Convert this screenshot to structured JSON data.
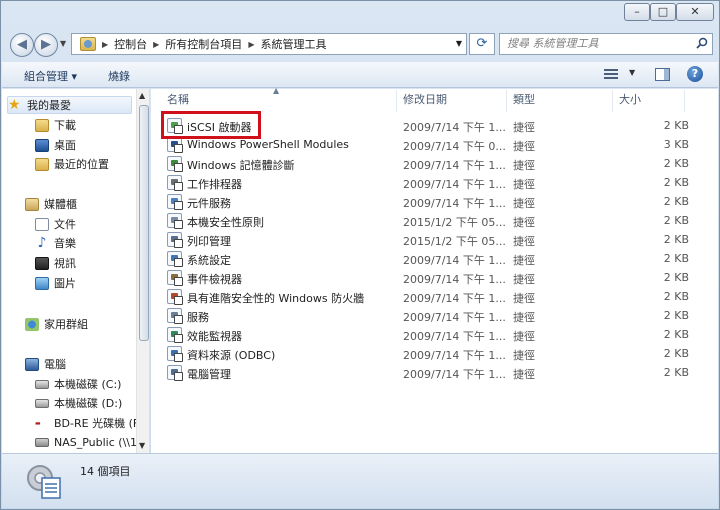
{
  "window": {
    "minimize_glyph": "–",
    "maximize_glyph": "□",
    "close_glyph": "✕"
  },
  "address_bar": {
    "breadcrumbs": [
      "控制台",
      "所有控制台項目",
      "系統管理工具"
    ]
  },
  "search": {
    "placeholder": "搜尋 系統管理工具"
  },
  "toolbar": {
    "organize_label": "組合管理 ▾",
    "burn_label": "燒錄"
  },
  "sidebar": {
    "favorites": {
      "label": "我的最愛",
      "items": [
        "下載",
        "桌面",
        "最近的位置"
      ]
    },
    "libraries": {
      "label": "媒體櫃",
      "items": [
        "文件",
        "音樂",
        "視訊",
        "圖片"
      ]
    },
    "homegroup": {
      "label": "家用群組"
    },
    "computer": {
      "label": "電腦",
      "items": [
        "本機磁碟 (C:)",
        "本機磁碟 (D:)",
        "BD-RE 光碟機 (F",
        "NAS_Public (\\\\1"
      ]
    }
  },
  "columns": {
    "name": "名稱",
    "modified": "修改日期",
    "type": "類型",
    "size": "大小"
  },
  "files": [
    {
      "name": "iSCSI 啟動器",
      "modified": "2009/7/14 下午 1...",
      "type": "捷徑",
      "size": "2 KB",
      "icon": "iscsi-icon",
      "color": "#4aa04a"
    },
    {
      "name": "Windows PowerShell Modules",
      "modified": "2009/7/14 下午 0...",
      "type": "捷徑",
      "size": "3 KB",
      "icon": "powershell-icon",
      "color": "#2a4f8f"
    },
    {
      "name": "Windows 記憶體診斷",
      "modified": "2009/7/14 下午 1...",
      "type": "捷徑",
      "size": "2 KB",
      "icon": "memory-diagnostic-icon",
      "color": "#3c8c3c"
    },
    {
      "name": "工作排程器",
      "modified": "2009/7/14 下午 1...",
      "type": "捷徑",
      "size": "2 KB",
      "icon": "task-scheduler-icon",
      "color": "#6d6d6d"
    },
    {
      "name": "元件服務",
      "modified": "2009/7/14 下午 1...",
      "type": "捷徑",
      "size": "2 KB",
      "icon": "component-services-icon",
      "color": "#4c7fc2"
    },
    {
      "name": "本機安全性原則",
      "modified": "2015/1/2 下午 05...",
      "type": "捷徑",
      "size": "2 KB",
      "icon": "security-policy-icon",
      "color": "#7a8aa0"
    },
    {
      "name": "列印管理",
      "modified": "2015/1/2 下午 05...",
      "type": "捷徑",
      "size": "2 KB",
      "icon": "print-management-icon",
      "color": "#5a6f8c"
    },
    {
      "name": "系統設定",
      "modified": "2009/7/14 下午 1...",
      "type": "捷徑",
      "size": "2 KB",
      "icon": "system-config-icon",
      "color": "#3f78b8"
    },
    {
      "name": "事件檢視器",
      "modified": "2009/7/14 下午 1...",
      "type": "捷徑",
      "size": "2 KB",
      "icon": "event-viewer-icon",
      "color": "#8a6d3b"
    },
    {
      "name": "具有進階安全性的 Windows 防火牆",
      "modified": "2009/7/14 下午 1...",
      "type": "捷徑",
      "size": "2 KB",
      "icon": "firewall-icon",
      "color": "#b24a2a"
    },
    {
      "name": "服務",
      "modified": "2009/7/14 下午 1...",
      "type": "捷徑",
      "size": "2 KB",
      "icon": "services-icon",
      "color": "#6a7f96"
    },
    {
      "name": "效能監視器",
      "modified": "2009/7/14 下午 1...",
      "type": "捷徑",
      "size": "2 KB",
      "icon": "performance-monitor-icon",
      "color": "#2f8a5a"
    },
    {
      "name": "資料來源 (ODBC)",
      "modified": "2009/7/14 下午 1...",
      "type": "捷徑",
      "size": "2 KB",
      "icon": "odbc-icon",
      "color": "#3a6fb0"
    },
    {
      "name": "電腦管理",
      "modified": "2009/7/14 下午 1...",
      "type": "捷徑",
      "size": "2 KB",
      "icon": "computer-management-icon",
      "color": "#4f6d92"
    }
  ],
  "status": {
    "item_count": "14 個項目"
  }
}
